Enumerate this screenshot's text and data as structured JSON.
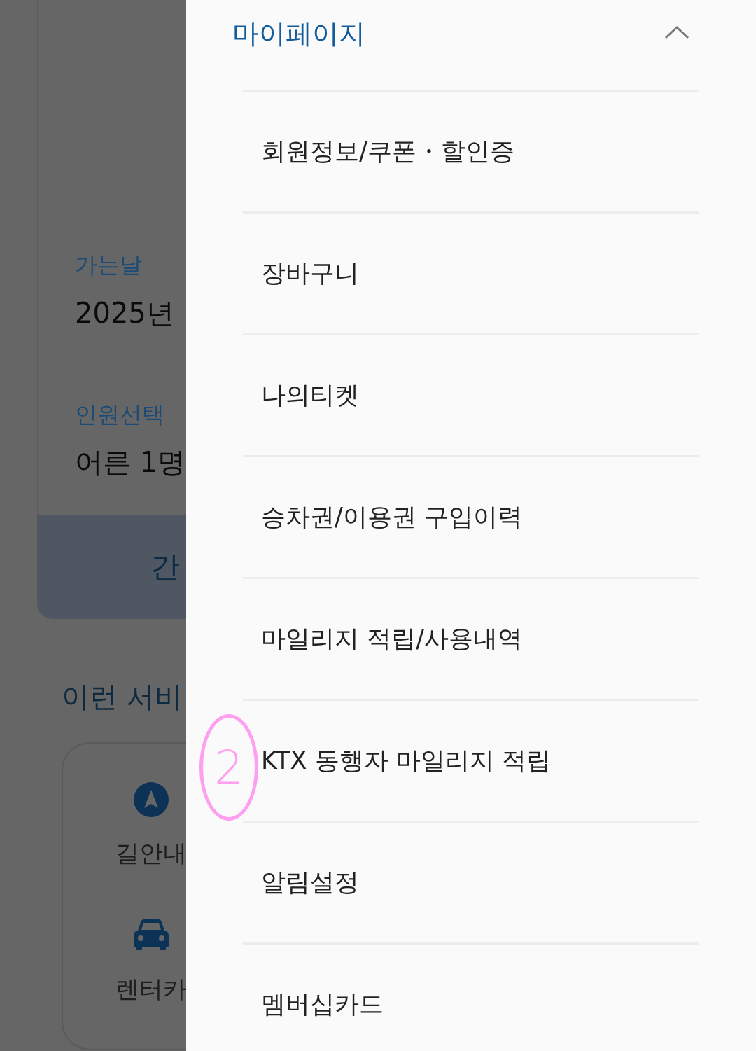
{
  "background_page": {
    "date_label": "가는날",
    "date_value": "2025년",
    "passenger_label": "인원선택",
    "passenger_value": "어른 1명",
    "submit_button": "간",
    "services_heading": "이런 서비",
    "services": [
      {
        "kind": "navigation",
        "label": "길안내"
      },
      {
        "kind": "car",
        "label": "렌터카"
      }
    ]
  },
  "menu": {
    "title": "마이페이지",
    "expanded": true,
    "items": [
      {
        "label": "회원정보/쿠폰・할인증"
      },
      {
        "label": "장바구니"
      },
      {
        "label": "나의티켓"
      },
      {
        "label": "승차권/이용권 구입이력"
      },
      {
        "label": "마일리지 적립/사용내역"
      },
      {
        "label": "KTX 동행자 마일리지 적립",
        "annotation": "2"
      },
      {
        "label": "알림설정"
      },
      {
        "label": "멤버십카드"
      }
    ]
  }
}
